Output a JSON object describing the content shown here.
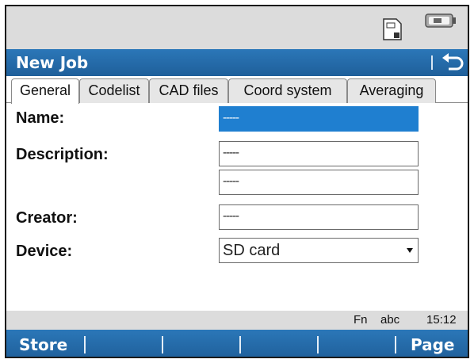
{
  "title": "New Job",
  "tabs": [
    {
      "label": "General",
      "active": true
    },
    {
      "label": "Codelist",
      "active": false
    },
    {
      "label": "CAD files",
      "active": false
    },
    {
      "label": "Coord system",
      "active": false
    },
    {
      "label": "Averaging",
      "active": false
    }
  ],
  "form": {
    "name_label": "Name:",
    "name_value": "-----",
    "description_label": "Description:",
    "description_line1": "-----",
    "description_line2": "-----",
    "creator_label": "Creator:",
    "creator_value": "-----",
    "device_label": "Device:",
    "device_value": "SD card"
  },
  "status": {
    "fn": "Fn",
    "input_mode": "abc",
    "time": "15:12"
  },
  "softkeys": {
    "f1": "Store",
    "f6": "Page"
  },
  "icons": {
    "storage": "sd-card-icon",
    "battery": "battery-icon",
    "back": "back-arrow-icon"
  },
  "colors": {
    "titlebar": "#1f5f9a",
    "focused_field": "#1f7fd0",
    "statusbar": "#dcdcdc"
  }
}
